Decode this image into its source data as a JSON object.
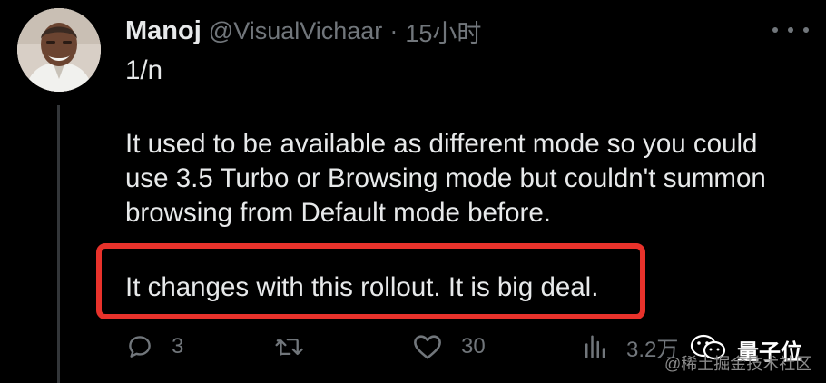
{
  "tweet": {
    "author": {
      "name": "Manoj",
      "handle": "@VisualVichaar",
      "separator": "·",
      "time": "15小时"
    },
    "text": {
      "numbering": "1/n",
      "paragraph_lines": [
        "It used to be available as different mode so you could",
        "use 3.5 Turbo or Browsing mode but couldn't summon",
        "browsing from Default mode before."
      ],
      "highlighted": "It changes with this rollout. It is big deal."
    },
    "actions": {
      "replies": "3",
      "retweets": "",
      "likes": "30",
      "views": "3.2万"
    }
  },
  "watermark": {
    "name": "量子位",
    "sub": "@稀土掘金技术社区"
  },
  "colors": {
    "background": "#000000",
    "text_primary": "#e7e9ea",
    "text_secondary": "#71767b",
    "highlight_border": "#e8322b"
  }
}
